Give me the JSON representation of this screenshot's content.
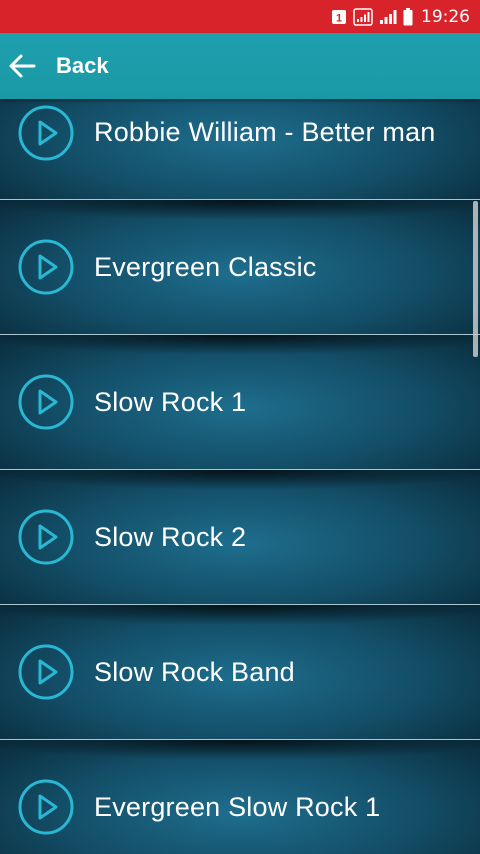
{
  "status_bar": {
    "time": "19:26",
    "notification_badge": "1",
    "icons": [
      "notification-badge-icon",
      "signal-bars-icon",
      "signal-icon",
      "battery-icon"
    ]
  },
  "app_bar": {
    "back_label": "Back",
    "back_icon": "arrow-left-icon",
    "color": "#1fa0ae"
  },
  "list": {
    "items": [
      {
        "label": "Robbie William - Better man",
        "icon": "play-circle-icon"
      },
      {
        "label": "Evergreen Classic",
        "icon": "play-circle-icon"
      },
      {
        "label": "Slow Rock 1",
        "icon": "play-circle-icon"
      },
      {
        "label": "Slow Rock 2",
        "icon": "play-circle-icon"
      },
      {
        "label": "Slow Rock Band",
        "icon": "play-circle-icon"
      },
      {
        "label": "Evergreen Slow Rock 1",
        "icon": "play-circle-icon"
      }
    ],
    "accent_color": "#29b8d4"
  }
}
